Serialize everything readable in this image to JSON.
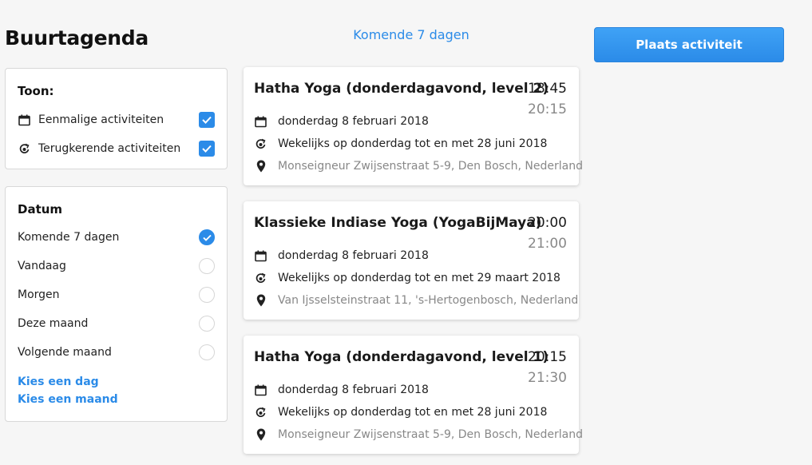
{
  "page": {
    "title": "Buurtagenda"
  },
  "filters": {
    "show": {
      "heading": "Toon:",
      "items": [
        {
          "label": "Eenmalige activiteiten",
          "icon": "calendar-icon",
          "checked": true
        },
        {
          "label": "Terugkerende activiteiten",
          "icon": "recurring-icon",
          "checked": true
        }
      ]
    },
    "date": {
      "heading": "Datum",
      "options": [
        {
          "label": "Komende 7 dagen",
          "selected": true
        },
        {
          "label": "Vandaag",
          "selected": false
        },
        {
          "label": "Morgen",
          "selected": false
        },
        {
          "label": "Deze maand",
          "selected": false
        },
        {
          "label": "Volgende maand",
          "selected": false
        }
      ],
      "links": [
        "Kies een dag",
        "Kies een maand"
      ]
    }
  },
  "period_title": "Komende 7 dagen",
  "post_button": "Plaats activiteit",
  "activities": [
    {
      "title": "Hatha Yoga (donderdagavond, level 2)",
      "start": "18:45",
      "end": "20:15",
      "date": "donderdag 8 februari 2018",
      "recurrence": "Wekelijks op donderdag tot en met 28 juni 2018",
      "address": "Monseigneur Zwijsenstraat 5-9, Den Bosch, Nederland"
    },
    {
      "title": "Klassieke Indiase Yoga (YogaBijMaya)",
      "start": "20:00",
      "end": "21:00",
      "date": "donderdag 8 februari 2018",
      "recurrence": "Wekelijks op donderdag tot en met 29 maart 2018",
      "address": "Van Ijsselsteinstraat 11, 's-Hertogenbosch, Nederland"
    },
    {
      "title": "Hatha Yoga (donderdagavond, level 1)",
      "start": "20:15",
      "end": "21:30",
      "date": "donderdag 8 februari 2018",
      "recurrence": "Wekelijks op donderdag tot en met 28 juni 2018",
      "address": "Monseigneur Zwijsenstraat 5-9, Den Bosch, Nederland"
    }
  ],
  "colors": {
    "accent": "#2b8be8",
    "muted": "#888888",
    "background": "#f6f6f6"
  }
}
